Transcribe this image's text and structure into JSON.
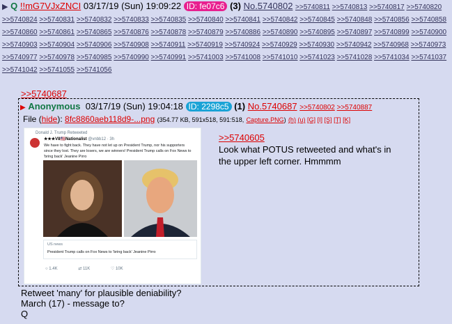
{
  "post": {
    "arrow": "▶",
    "name": "Q",
    "tripcode": "!!mG7VJxZNCI",
    "date": "03/17/19 (Sun) 19:09:22",
    "id_label": "ID: fe07c6",
    "count": "(3)",
    "number": "No.5740802",
    "backlinks": [
      ">>5740811",
      ">>5740813",
      ">>5740817",
      ">>5740820",
      ">>5740824",
      ">>5740831",
      ">>5740832",
      ">>5740833",
      ">>5740835",
      ">>5740840",
      ">>5740841",
      ">>5740842",
      ">>5740845",
      ">>5740848",
      ">>5740856",
      ">>5740858",
      ">>5740860",
      ">>5740861",
      ">>5740865",
      ">>5740876",
      ">>5740878",
      ">>5740879",
      ">>5740886",
      ">>5740890",
      ">>5740895",
      ">>5740897",
      ">>5740899",
      ">>5740900",
      ">>5740903",
      ">>5740904",
      ">>5740906",
      ">>5740908",
      ">>5740911",
      ">>5740919",
      ">>5740924",
      ">>5740929",
      ">>5740930",
      ">>5740942",
      ">>5740968",
      ">>5740973",
      ">>5740977",
      ">>5740978",
      ">>5740985",
      ">>5740990",
      ">>5740991",
      ">>5741003",
      ">>5741008",
      ">>5741010",
      ">>5741023",
      ">>5741028",
      ">>5741034",
      ">>5741037",
      ">>5741042",
      ">>5741055",
      ">>5741056"
    ],
    "quote_link": ">>5740687",
    "message_lines": [
      "Retweet 'many' for plausible deniability?",
      "March (17) - message to?",
      "Q"
    ]
  },
  "reply": {
    "arrow": "▶",
    "name": "Anonymous",
    "date": "03/17/19 (Sun) 19:04:18",
    "id_label": "ID: 2298c5",
    "count": "(1)",
    "number": "No.5740687",
    "backlinks": [
      ">>5740802",
      ">>5740887"
    ],
    "file_prefix": "File (",
    "hide_label": "hide",
    "file_mid": "): ",
    "filename": "8fc8860aeb118d9-...png",
    "file_meta": "(354.77 KB, 591x518, 591:518,",
    "capture_label": "Capture.PNG",
    "file_tail": ")",
    "file_tools": [
      "(h)",
      "(u)",
      "[G]",
      "[I]",
      "[S]",
      "[T]",
      "[K]"
    ],
    "quote_link": ">>5740605",
    "text_lines": [
      "Look what POTUS retweeted and what's in",
      "the upper left corner.  Hmmmm"
    ]
  },
  "thumbnail": {
    "retweet_line": "Donald J. Trump Retweeted",
    "user_name": "★★★V8🇺🇸Nationalist",
    "user_handle": "@vnbb12 · 3h",
    "tweet_text": "We have to fight back. They have not let up on President Trump, nor his supporters since they lost. They are losers, we are winners! President Trump calls on Fox News to 'bring back' Jeanine Pirro",
    "card_source": "US news",
    "card_title": "President Trump calls on Fox News to 'bring back' Jeanine Pirro",
    "actions": [
      "1.4K",
      "11K",
      "10K"
    ]
  },
  "colors": {
    "background": "#d6daf0",
    "link": "#34345c",
    "name_green": "#117743",
    "quote_red": "#dd0000",
    "q_id_badge": "#e81f8f",
    "anon_id_badge": "#1aa3d6"
  }
}
